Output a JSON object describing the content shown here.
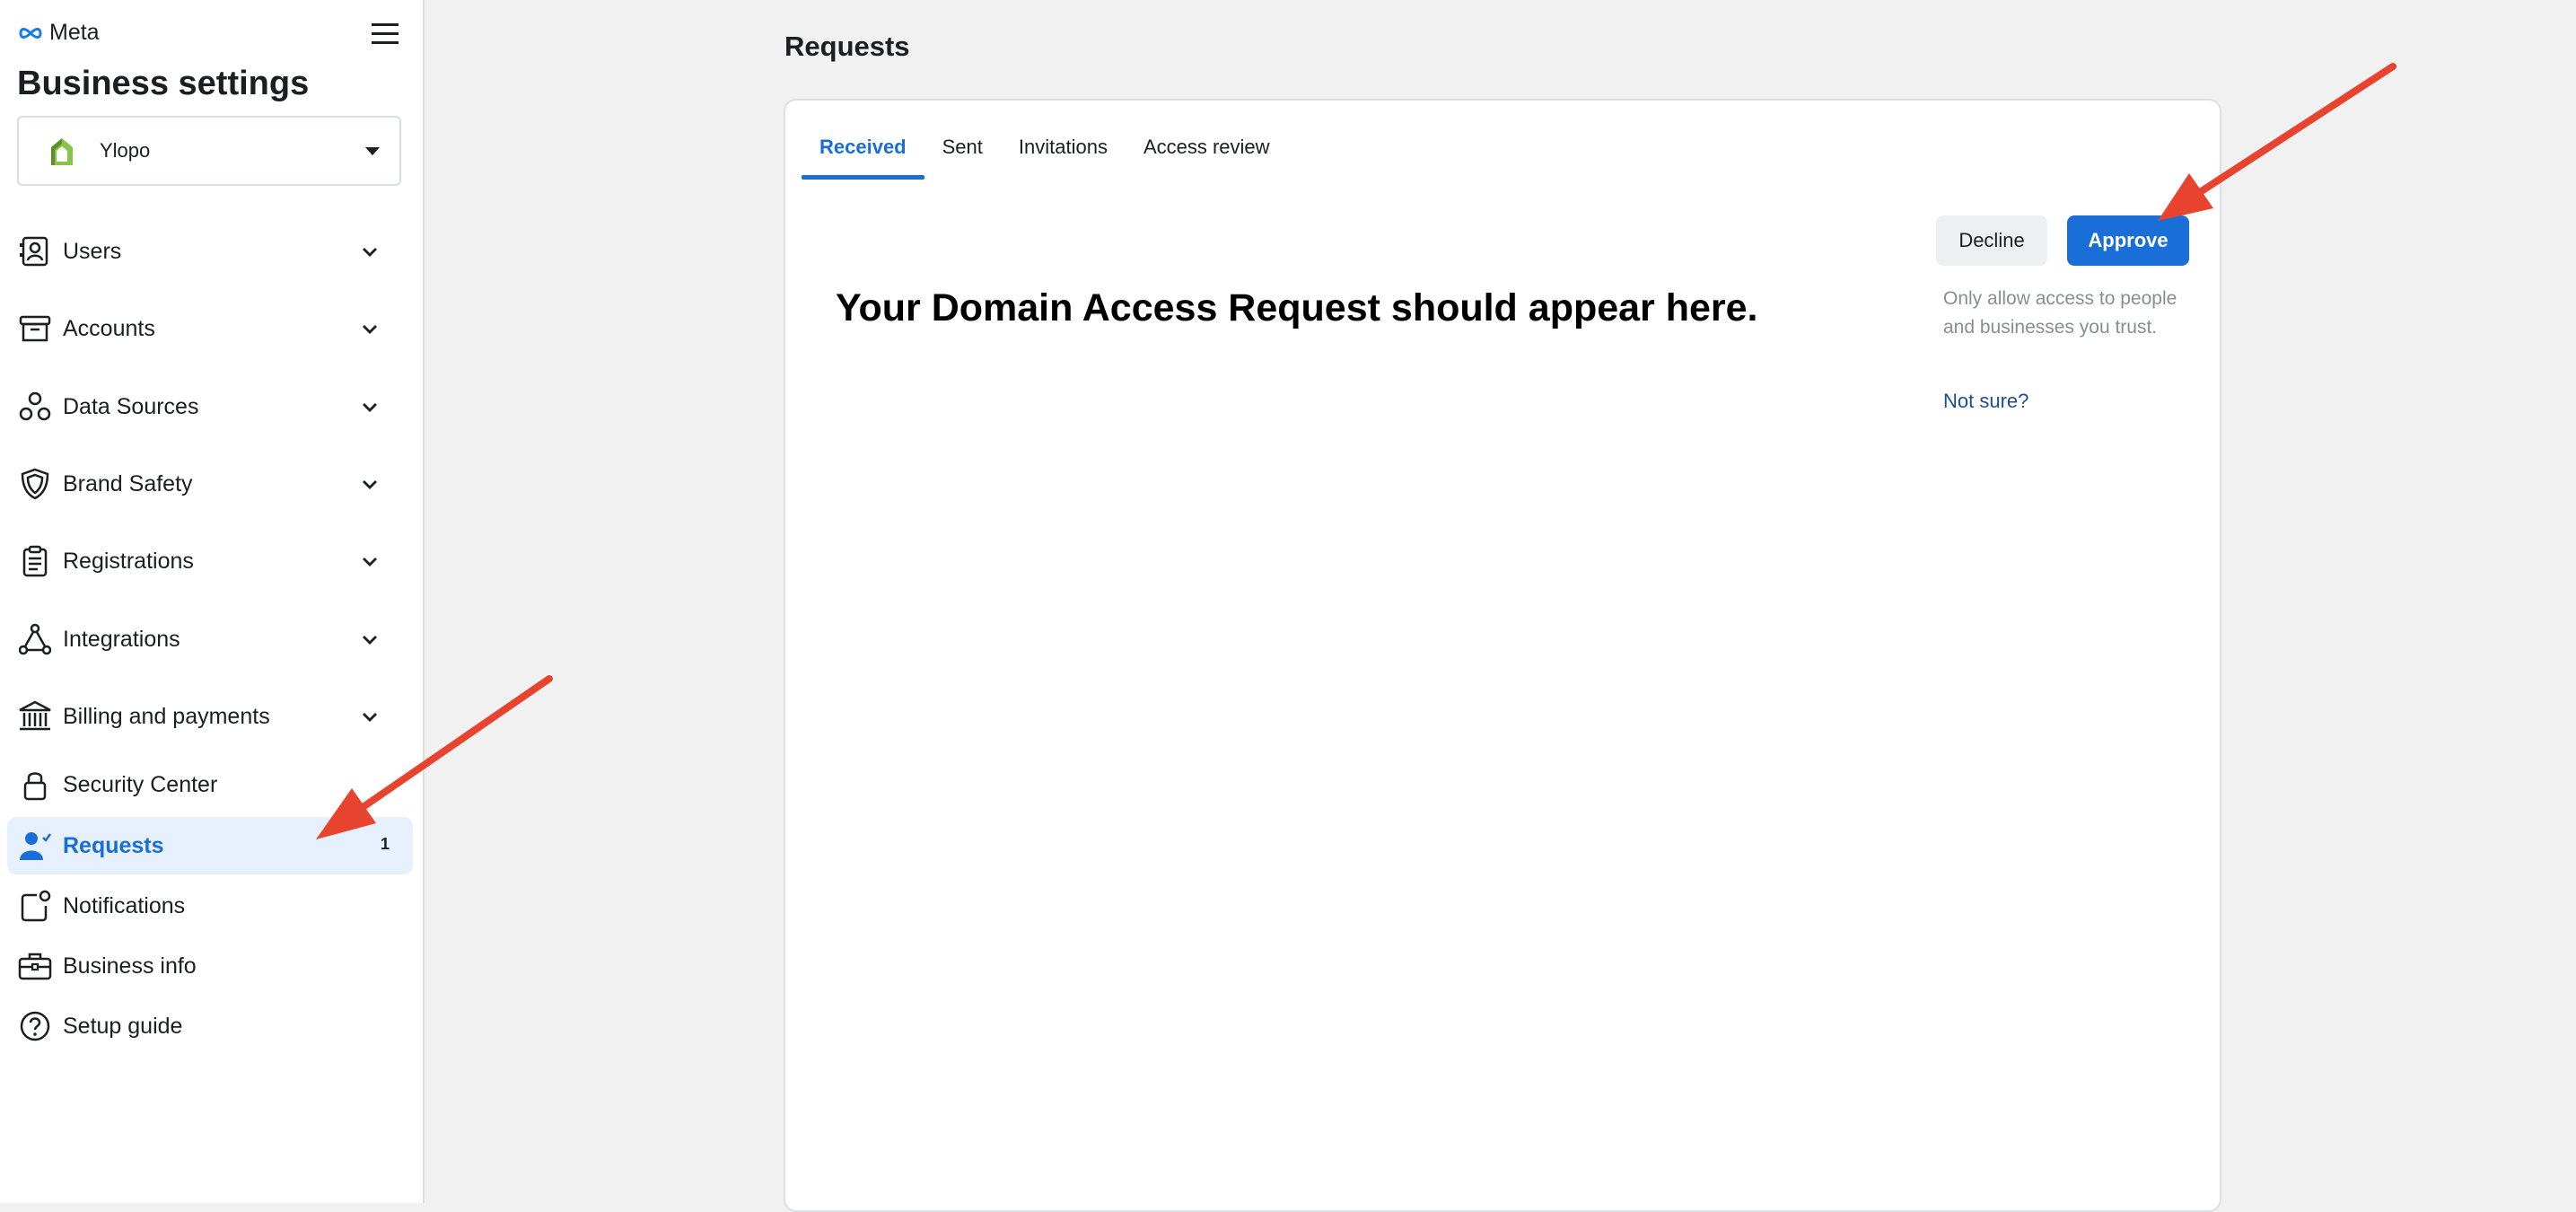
{
  "brand": {
    "name": "Meta"
  },
  "sidebar": {
    "title": "Business settings",
    "business": {
      "name": "Ylopo"
    },
    "items": [
      {
        "label": "Users",
        "icon": "users-icon",
        "expandable": true
      },
      {
        "label": "Accounts",
        "icon": "accounts-icon",
        "expandable": true
      },
      {
        "label": "Data Sources",
        "icon": "data-sources-icon",
        "expandable": true
      },
      {
        "label": "Brand Safety",
        "icon": "shield-icon",
        "expandable": true
      },
      {
        "label": "Registrations",
        "icon": "clipboard-icon",
        "expandable": true
      },
      {
        "label": "Integrations",
        "icon": "integrations-icon",
        "expandable": true
      },
      {
        "label": "Billing and payments",
        "icon": "bank-icon",
        "expandable": true
      },
      {
        "label": "Security Center",
        "icon": "lock-icon",
        "expandable": false
      },
      {
        "label": "Requests",
        "icon": "person-check-icon",
        "expandable": false,
        "active": true,
        "badge": "1"
      },
      {
        "label": "Notifications",
        "icon": "notification-icon",
        "expandable": false
      },
      {
        "label": "Business info",
        "icon": "briefcase-icon",
        "expandable": false
      },
      {
        "label": "Setup guide",
        "icon": "question-icon",
        "expandable": false
      }
    ]
  },
  "main": {
    "title": "Requests",
    "tabs": [
      {
        "label": "Received",
        "active": true
      },
      {
        "label": "Sent"
      },
      {
        "label": "Invitations"
      },
      {
        "label": "Access review"
      }
    ],
    "message": "Your Domain Access Request should appear here.",
    "decline_label": "Decline",
    "approve_label": "Approve",
    "hint": "Only allow access to people and businesses you trust.",
    "not_sure": "Not sure?"
  },
  "colors": {
    "accent": "#1a6ed8",
    "arrow": "#e8432e",
    "active_bg": "#e7f0fd",
    "page_bg": "#f1f1f1"
  }
}
